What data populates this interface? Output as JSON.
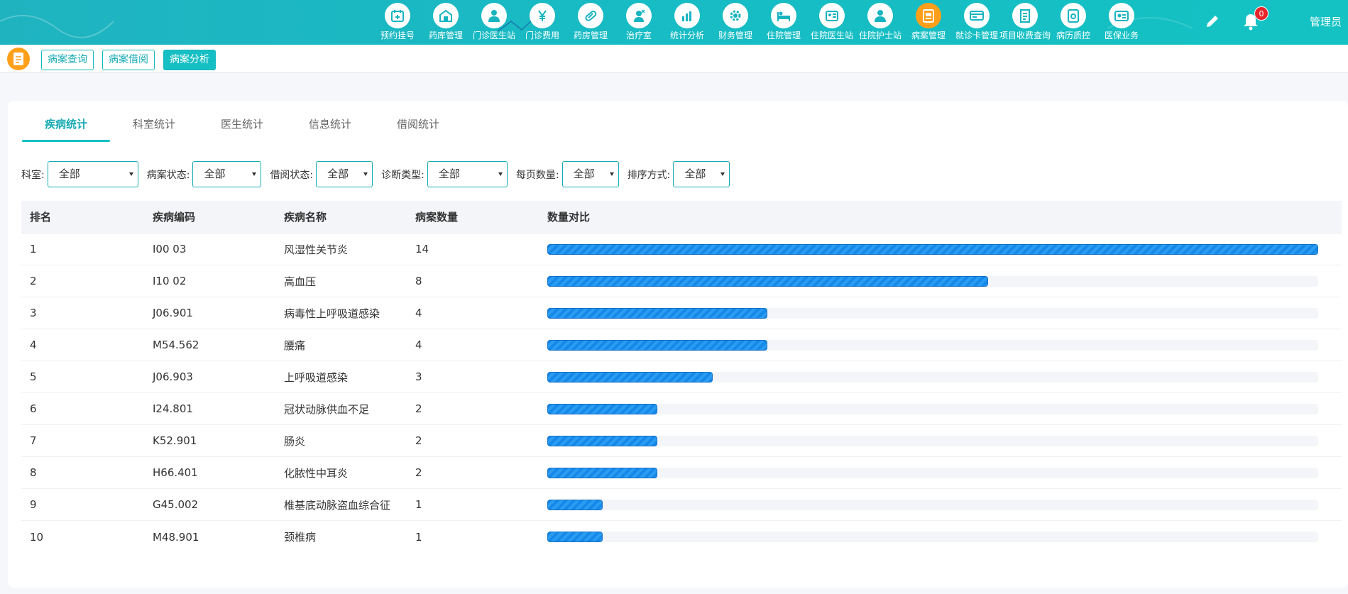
{
  "nav": [
    {
      "label": "预约挂号",
      "icon": "calendar-plus-icon"
    },
    {
      "label": "药库管理",
      "icon": "warehouse-icon"
    },
    {
      "label": "门诊医生站",
      "icon": "doctor-icon"
    },
    {
      "label": "门诊费用",
      "icon": "yuan-icon"
    },
    {
      "label": "药房管理",
      "icon": "pill-icon"
    },
    {
      "label": "治疗室",
      "icon": "nurse-icon"
    },
    {
      "label": "统计分析",
      "icon": "chart-icon"
    },
    {
      "label": "财务管理",
      "icon": "gear-coin-icon"
    },
    {
      "label": "住院管理",
      "icon": "bed-icon"
    },
    {
      "label": "住院医生站",
      "icon": "doctor-card-icon"
    },
    {
      "label": "住院护士站",
      "icon": "nurse-station-icon"
    },
    {
      "label": "病案管理",
      "icon": "record-icon",
      "active": true
    },
    {
      "label": "就诊卡管理",
      "icon": "card-icon"
    },
    {
      "label": "项目收费查询",
      "icon": "receipt-icon"
    },
    {
      "label": "病历质控",
      "icon": "quality-icon"
    },
    {
      "label": "医保业务",
      "icon": "insurance-icon"
    }
  ],
  "header": {
    "notification_count": "0",
    "user": "管理员"
  },
  "subtabs": [
    {
      "label": "病案查询"
    },
    {
      "label": "病案借阅"
    },
    {
      "label": "病案分析",
      "active": true
    }
  ],
  "tabs": [
    {
      "label": "疾病统计",
      "active": true
    },
    {
      "label": "科室统计"
    },
    {
      "label": "医生统计"
    },
    {
      "label": "信息统计"
    },
    {
      "label": "借阅统计"
    }
  ],
  "filters": [
    {
      "label": "科室:",
      "value": "全部"
    },
    {
      "label": "病案状态:",
      "value": "全部"
    },
    {
      "label": "借阅状态:",
      "value": "全部"
    },
    {
      "label": "诊断类型:",
      "value": "全部"
    },
    {
      "label": "每页数量:",
      "value": "全部"
    },
    {
      "label": "排序方式:",
      "value": "全部"
    }
  ],
  "table": {
    "headers": [
      "排名",
      "疾病编码",
      "疾病名称",
      "病案数量",
      "数量对比"
    ],
    "rows": [
      {
        "rank": "1",
        "code": "I00 03",
        "name": "风湿性关节炎",
        "count": "14"
      },
      {
        "rank": "2",
        "code": "I10 02",
        "name": "高血压",
        "count": "8"
      },
      {
        "rank": "3",
        "code": "J06.901",
        "name": "病毒性上呼吸道感染",
        "count": "4"
      },
      {
        "rank": "4",
        "code": "M54.562",
        "name": "腰痛",
        "count": "4"
      },
      {
        "rank": "5",
        "code": "J06.903",
        "name": "上呼吸道感染",
        "count": "3"
      },
      {
        "rank": "6",
        "code": "I24.801",
        "name": "冠状动脉供血不足",
        "count": "2"
      },
      {
        "rank": "7",
        "code": "K52.901",
        "name": "肠炎",
        "count": "2"
      },
      {
        "rank": "8",
        "code": "H66.401",
        "name": "化脓性中耳炎",
        "count": "2"
      },
      {
        "rank": "9",
        "code": "G45.002",
        "name": "椎基底动脉盗血综合征",
        "count": "1"
      },
      {
        "rank": "10",
        "code": "M48.901",
        "name": "颈椎病",
        "count": "1"
      }
    ]
  },
  "colors": {
    "header_bg": "#17bcc4",
    "accent": "#16bfc4",
    "active_nav": "#ff9f1a",
    "bar": "#1589e8",
    "badge": "#e8242b"
  }
}
